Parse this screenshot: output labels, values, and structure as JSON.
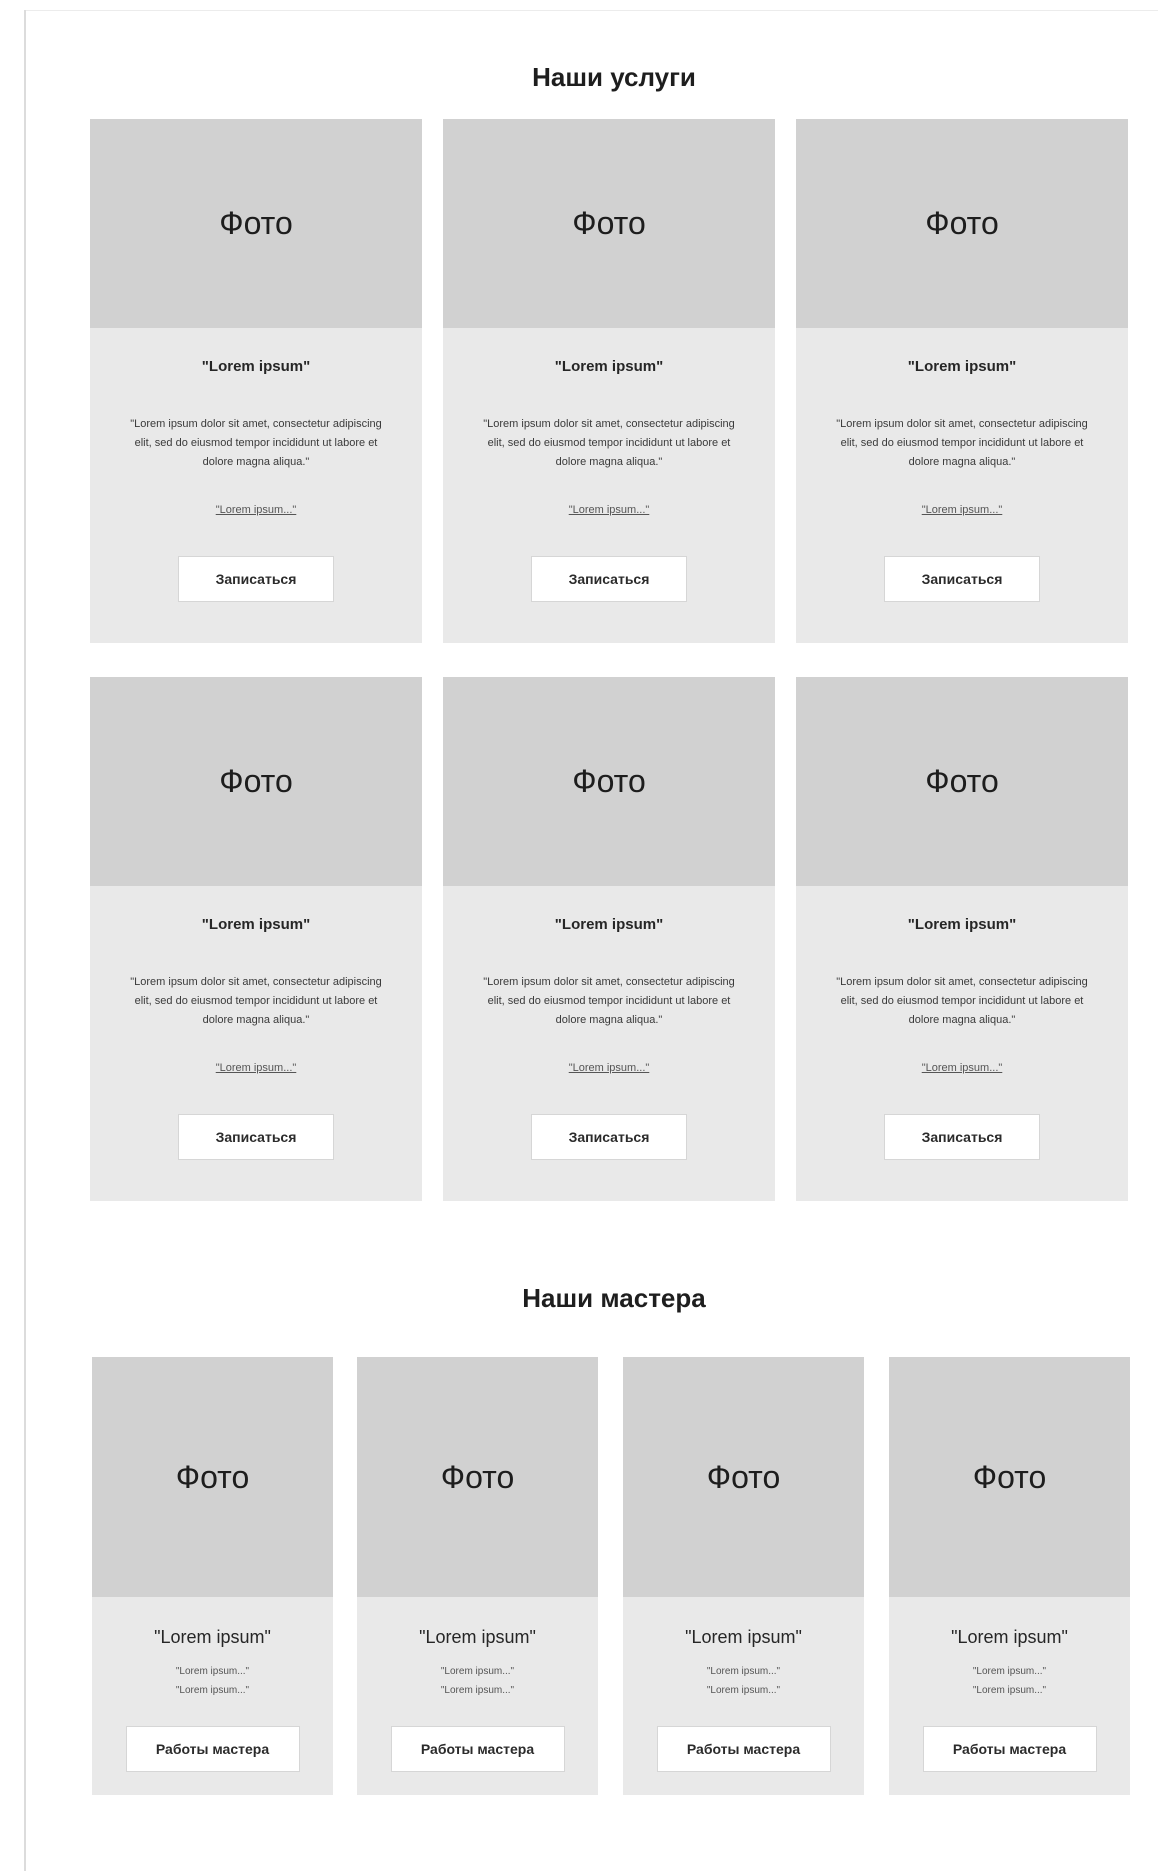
{
  "services": {
    "title": "Наши услуги",
    "cards": [
      {
        "photo": "Фото",
        "title": "\"Lorem ipsum\"",
        "description": "\"Lorem ipsum dolor sit amet, consectetur adipiscing elit, sed do eiusmod tempor incididunt ut labore et dolore magna aliqua.\"",
        "link": "\"Lorem ipsum...\"",
        "button": "Записаться"
      },
      {
        "photo": "Фото",
        "title": "\"Lorem ipsum\"",
        "description": "\"Lorem ipsum dolor sit amet, consectetur adipiscing elit, sed do eiusmod tempor incididunt ut labore et dolore magna aliqua.\"",
        "link": "\"Lorem ipsum...\"",
        "button": "Записаться"
      },
      {
        "photo": "Фото",
        "title": "\"Lorem ipsum\"",
        "description": "\"Lorem ipsum dolor sit amet, consectetur adipiscing elit, sed do eiusmod tempor incididunt ut labore et dolore magna aliqua.\"",
        "link": "\"Lorem ipsum...\"",
        "button": "Записаться"
      },
      {
        "photo": "Фото",
        "title": "\"Lorem ipsum\"",
        "description": "\"Lorem ipsum dolor sit amet, consectetur adipiscing elit, sed do eiusmod tempor incididunt ut labore et dolore magna aliqua.\"",
        "link": "\"Lorem ipsum...\"",
        "button": "Записаться"
      },
      {
        "photo": "Фото",
        "title": "\"Lorem ipsum\"",
        "description": "\"Lorem ipsum dolor sit amet, consectetur adipiscing elit, sed do eiusmod tempor incididunt ut labore et dolore magna aliqua.\"",
        "link": "\"Lorem ipsum...\"",
        "button": "Записаться"
      },
      {
        "photo": "Фото",
        "title": "\"Lorem ipsum\"",
        "description": "\"Lorem ipsum dolor sit amet, consectetur adipiscing elit, sed do eiusmod tempor incididunt ut labore et dolore magna aliqua.\"",
        "link": "\"Lorem ipsum...\"",
        "button": "Записаться"
      }
    ]
  },
  "masters": {
    "title": "Наши мастера",
    "cards": [
      {
        "photo": "Фото",
        "title": "\"Lorem ipsum\"",
        "line1": "\"Lorem ipsum...\"",
        "line2": "\"Lorem ipsum...\"",
        "button": "Работы мастера"
      },
      {
        "photo": "Фото",
        "title": "\"Lorem ipsum\"",
        "line1": "\"Lorem ipsum...\"",
        "line2": "\"Lorem ipsum...\"",
        "button": "Работы мастера"
      },
      {
        "photo": "Фото",
        "title": "\"Lorem ipsum\"",
        "line1": "\"Lorem ipsum...\"",
        "line2": "\"Lorem ipsum...\"",
        "button": "Работы мастера"
      },
      {
        "photo": "Фото",
        "title": "\"Lorem ipsum\"",
        "line1": "\"Lorem ipsum...\"",
        "line2": "\"Lorem ipsum...\"",
        "button": "Работы мастера"
      }
    ]
  }
}
